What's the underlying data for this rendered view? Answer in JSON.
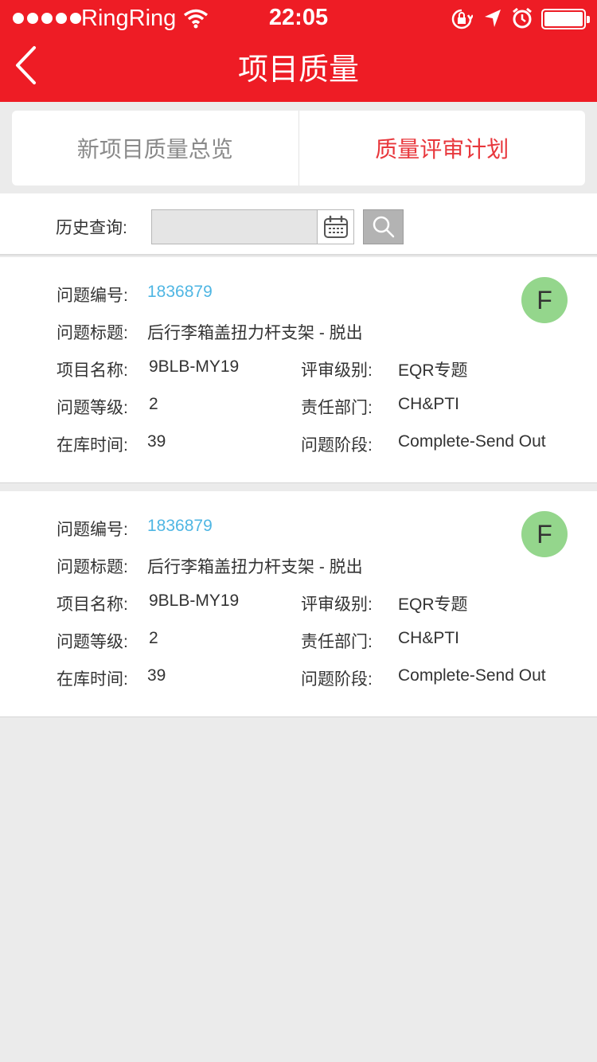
{
  "status_bar": {
    "carrier": "RingRing",
    "time": "22:05"
  },
  "header": {
    "title": "项目质量"
  },
  "tabs": [
    {
      "label": "新项目质量总览",
      "active": false
    },
    {
      "label": "质量评审计划",
      "active": true
    }
  ],
  "search": {
    "label": "历史查询:",
    "date_value": ""
  },
  "colors": {
    "brand": "#ee1c25",
    "active_tab": "#e8373c",
    "link": "#4fb6e3",
    "badge": "#94d68c"
  },
  "cards": [
    {
      "id_label": "问题编号:",
      "id_value": "1836879",
      "title_label": "问题标题:",
      "title_value": "后行李箱盖扭力杆支架 - 脱出",
      "project_label": "项目名称:",
      "project_value": "9BLB-MY19",
      "review_label": "评审级别:",
      "review_value": "EQR专题",
      "level_label": "问题等级:",
      "level_value": "2",
      "dept_label": "责任部门:",
      "dept_value": "CH&PTI",
      "time_label": "在库时间:",
      "time_value": "39",
      "stage_label": "问题阶段:",
      "stage_value": "Complete-Send Out",
      "badge": "F"
    },
    {
      "id_label": "问题编号:",
      "id_value": "1836879",
      "title_label": "问题标题:",
      "title_value": "后行李箱盖扭力杆支架 - 脱出",
      "project_label": "项目名称:",
      "project_value": "9BLB-MY19",
      "review_label": "评审级别:",
      "review_value": "EQR专题",
      "level_label": "问题等级:",
      "level_value": "2",
      "dept_label": "责任部门:",
      "dept_value": "CH&PTI",
      "time_label": "在库时间:",
      "time_value": "39",
      "stage_label": "问题阶段:",
      "stage_value": "Complete-Send Out",
      "badge": "F"
    }
  ]
}
